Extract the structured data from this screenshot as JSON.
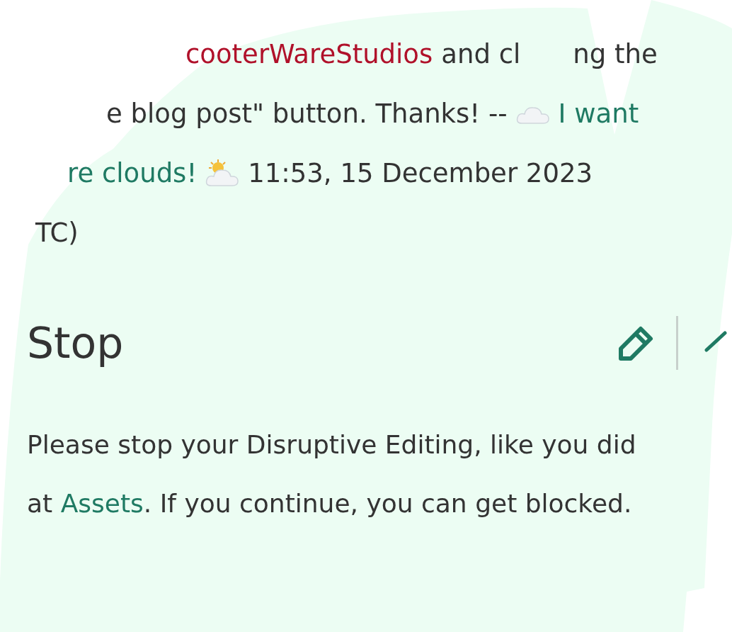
{
  "previous_comment": {
    "lines": [
      {
        "parts": [
          {
            "kind": "user_link",
            "text": "cooterWareStudios"
          },
          {
            "kind": "text",
            "text": "and cl"
          },
          {
            "kind": "gap_text",
            "text": "ng the"
          }
        ]
      },
      {
        "parts": [
          {
            "kind": "text",
            "text": "e blog post\" button. Thanks! --"
          },
          {
            "kind": "cloud"
          },
          {
            "kind": "link",
            "text": "I want"
          }
        ]
      },
      {
        "parts": [
          {
            "kind": "link",
            "text": "re clouds!"
          },
          {
            "kind": "sun_cloud"
          },
          {
            "kind": "text",
            "text": "11:53, 15 December 2023"
          }
        ]
      },
      {
        "parts": [
          {
            "kind": "text",
            "text": "TC)"
          }
        ]
      }
    ]
  },
  "section": {
    "heading": "Stop",
    "paragraph_before": "Please stop your Disruptive Editing, like you did at ",
    "link": "Assets",
    "paragraph_after": ". If you continue, you can get blocked."
  }
}
